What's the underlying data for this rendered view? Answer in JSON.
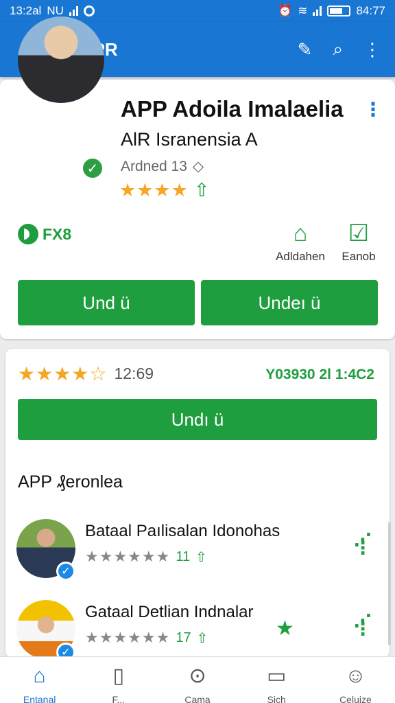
{
  "status_bar": {
    "time": "13:2al",
    "carrier": "NU",
    "battery_text": "84:77"
  },
  "app_bar": {
    "title": "AAPR"
  },
  "app": {
    "title": "APP Adoila Imalaelia",
    "subtitle": "AlR Isranensia A",
    "meta": "Ardned 13",
    "star_rating": 4,
    "badge": "FX8",
    "actions": [
      {
        "label": "Adldahen",
        "icon": "bookmark-icon"
      },
      {
        "label": "Eanob",
        "icon": "check-box-icon"
      }
    ],
    "buttons": [
      "Und ü",
      "Undeı ü"
    ]
  },
  "rating_summary": {
    "value": "12:69",
    "stars": 4.5,
    "version": "Y03930 2l 1:4C2",
    "button": "Undı ü"
  },
  "section": {
    "title": "APP ₰eronlea",
    "people": [
      {
        "name": "Bataal Paılisalan Idonohas",
        "count": "11",
        "stars": "★★★★★★"
      },
      {
        "name": "Gataal Detlian Indnalar",
        "count": "17",
        "stars": "★★★★★★"
      }
    ]
  },
  "bottom_nav": [
    {
      "label": "Entanal",
      "icon": "home-icon",
      "active": true
    },
    {
      "label": "F...",
      "icon": "devices-icon",
      "active": false
    },
    {
      "label": "Cama",
      "icon": "pin-icon",
      "active": false
    },
    {
      "label": "Sich",
      "icon": "folder-icon",
      "active": false
    },
    {
      "label": "Celuize",
      "icon": "person-icon",
      "active": false
    }
  ],
  "colors": {
    "primary": "#1976d2",
    "accent_green": "#1e9e3e",
    "star": "#f5a623"
  }
}
